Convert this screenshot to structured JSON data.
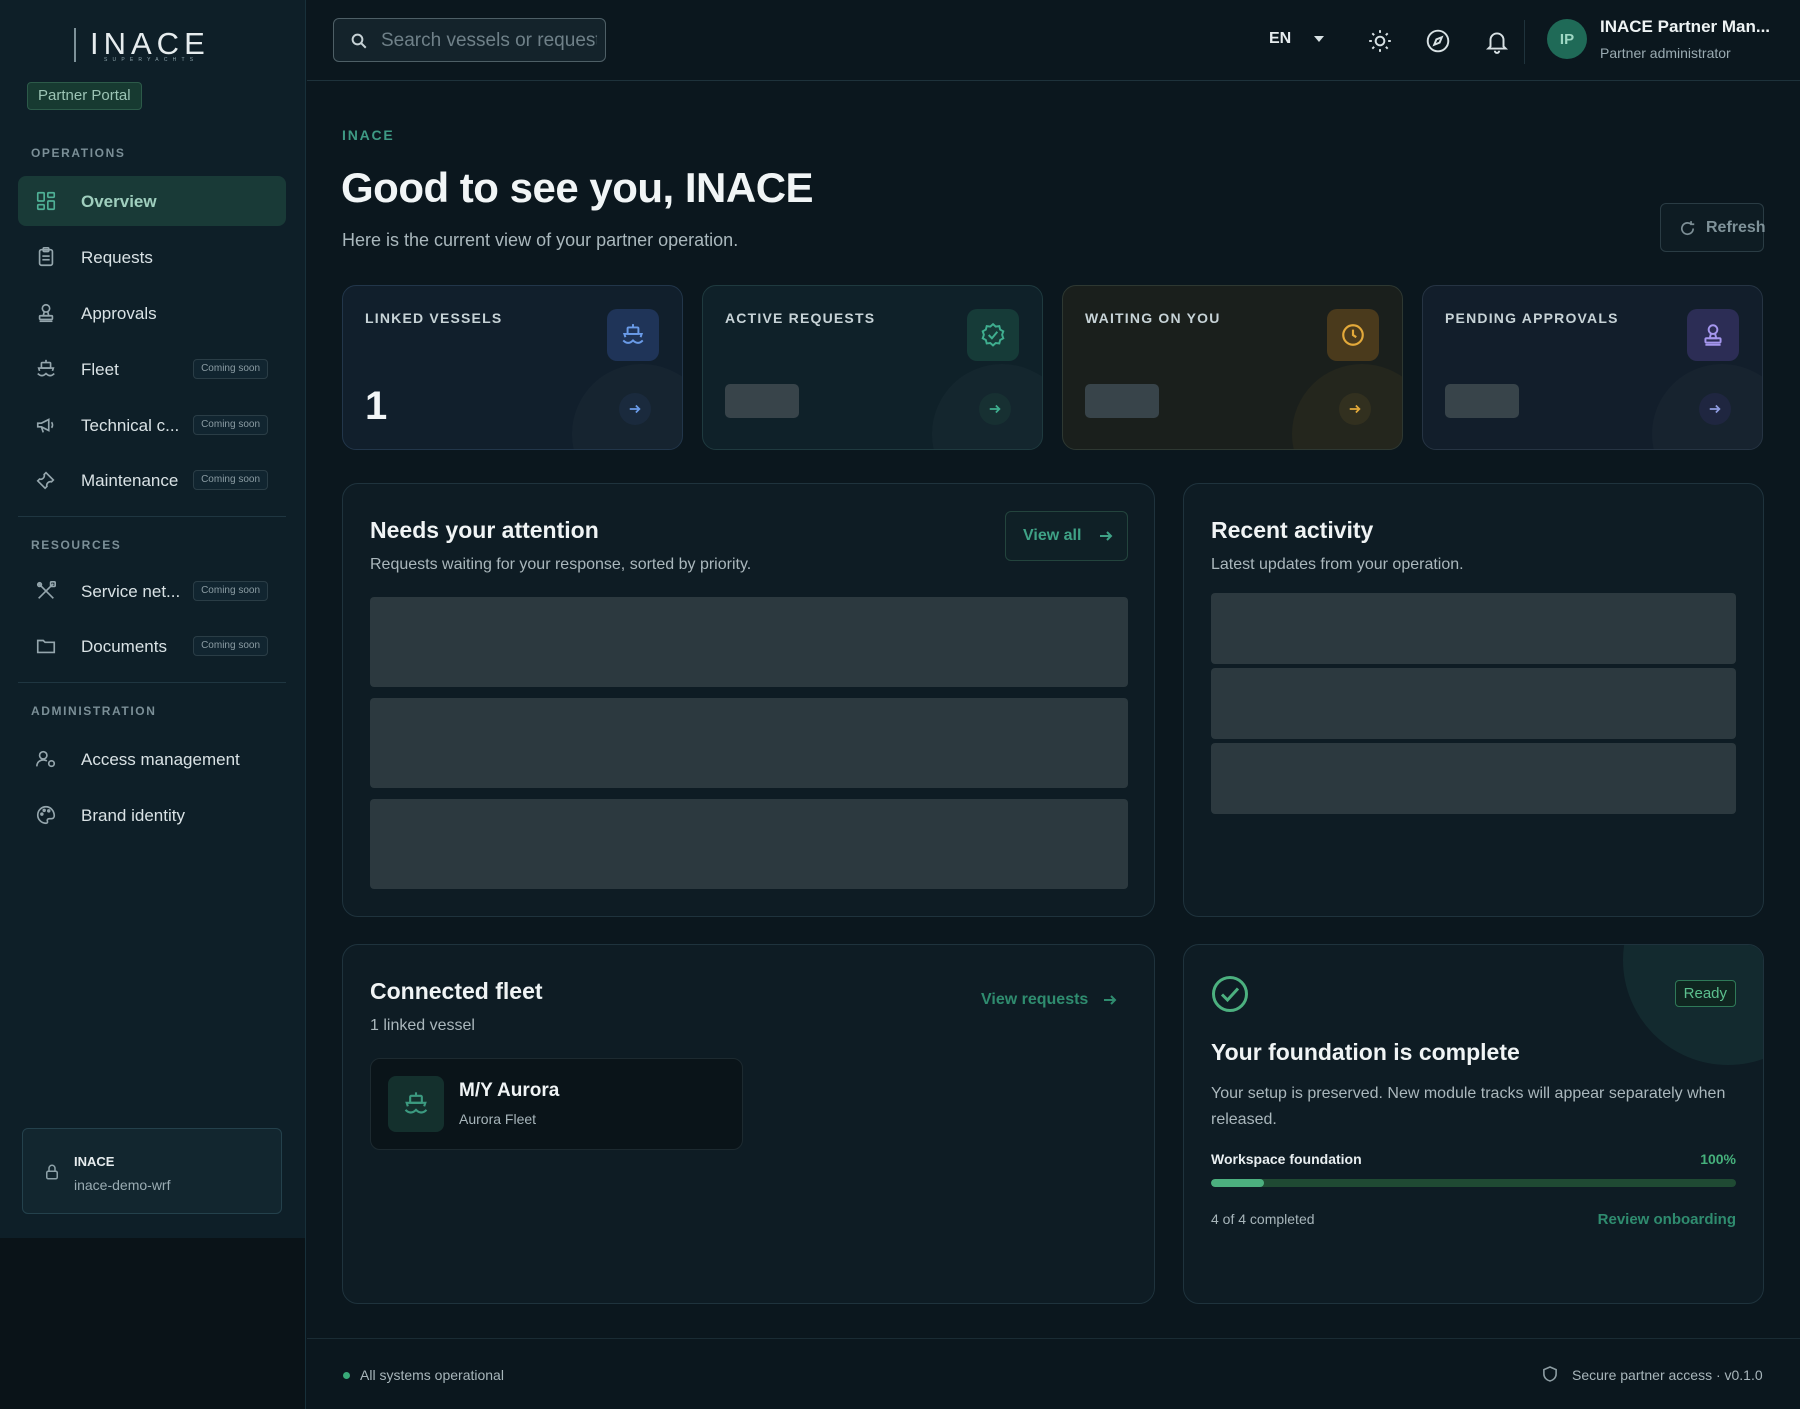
{
  "brand": {
    "logo_text": "INACE",
    "logo_subtext": "SUPERYACHTS",
    "portal_badge": "Partner Portal"
  },
  "sidebar": {
    "sections": [
      {
        "label": "OPERATIONS"
      },
      {
        "label": "RESOURCES"
      },
      {
        "label": "ADMINISTRATION"
      }
    ],
    "items": [
      {
        "label": "Overview",
        "icon": "grid-icon",
        "active": true
      },
      {
        "label": "Requests",
        "icon": "clipboard-icon"
      },
      {
        "label": "Approvals",
        "icon": "stamp-icon"
      },
      {
        "label": "Fleet",
        "icon": "ship-icon",
        "badge": "Coming soon"
      },
      {
        "label": "Technical c...",
        "icon": "megaphone-icon",
        "badge": "Coming soon"
      },
      {
        "label": "Maintenance",
        "icon": "wrench-icon",
        "badge": "Coming soon"
      },
      {
        "label": "Service net...",
        "icon": "tools-icon",
        "badge": "Coming soon"
      },
      {
        "label": "Documents",
        "icon": "folder-icon",
        "badge": "Coming soon"
      },
      {
        "label": "Access management",
        "icon": "user-gear-icon"
      },
      {
        "label": "Brand identity",
        "icon": "palette-icon"
      }
    ],
    "tenant": {
      "name": "INACE",
      "slug": "inace-demo-wrf"
    }
  },
  "topbar": {
    "search_placeholder": "Search vessels or requests",
    "language": "EN",
    "user": {
      "initials": "IP",
      "name": "INACE Partner Man...",
      "role": "Partner administrator"
    }
  },
  "main": {
    "eyebrow": "INACE",
    "greeting": "Good to see you, INACE",
    "subtitle": "Here is the current view of your partner operation.",
    "refresh_label": "Refresh",
    "stats": [
      {
        "label": "LINKED VESSELS",
        "value": "1",
        "icon": "ship-icon",
        "accent": "#5b8fe0"
      },
      {
        "label": "ACTIVE REQUESTS",
        "value": null,
        "icon": "badge-check-icon",
        "accent": "#3fae8f"
      },
      {
        "label": "WAITING ON YOU",
        "value": null,
        "icon": "clock-icon",
        "accent": "#e3a93a"
      },
      {
        "label": "PENDING APPROVALS",
        "value": null,
        "icon": "stamp-icon",
        "accent": "#9b8ce6"
      }
    ],
    "attention": {
      "title": "Needs your attention",
      "subtitle": "Requests waiting for your response, sorted by priority.",
      "view_all": "View all"
    },
    "activity": {
      "title": "Recent activity",
      "subtitle": "Latest updates from your operation."
    },
    "fleet": {
      "title": "Connected fleet",
      "subtitle": "1 linked vessel",
      "view_requests": "View requests",
      "vessels": [
        {
          "name": "M/Y Aurora",
          "fleet": "Aurora Fleet"
        }
      ]
    },
    "foundation": {
      "badge": "Ready",
      "title": "Your foundation is complete",
      "text": "Your setup is preserved. New module tracks will appear separately when released.",
      "progress_label": "Workspace foundation",
      "progress_pct": "100%",
      "progress_fill_fraction": 0.1,
      "count": "4 of 4 completed",
      "review_link": "Review onboarding"
    }
  },
  "footer": {
    "status": "All systems operational",
    "secure": "Secure partner access · v0.1.0"
  }
}
